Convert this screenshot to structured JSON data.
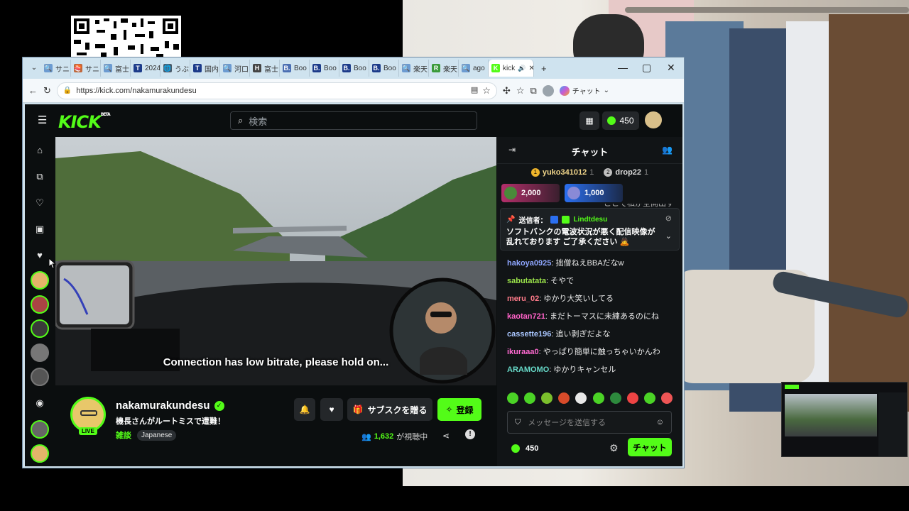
{
  "browser": {
    "tabs": [
      {
        "label": "サニ",
        "color": "#6c9bd1",
        "glyph": "🔍"
      },
      {
        "label": "サニ",
        "color": "#c0663b",
        "glyph": "🍣"
      },
      {
        "label": "富士",
        "color": "#6c9bd1",
        "glyph": "🔍"
      },
      {
        "label": "2024",
        "color": "#1c3b8a",
        "glyph": "T"
      },
      {
        "label": "うぶ",
        "color": "#4a5a6a",
        "glyph": "🌐"
      },
      {
        "label": "国内",
        "color": "#1c3b8a",
        "glyph": "T"
      },
      {
        "label": "河口",
        "color": "#6c9bd1",
        "glyph": "🔍"
      },
      {
        "label": "富士",
        "color": "#444",
        "glyph": "H"
      },
      {
        "label": "Boo",
        "color": "#4b6fb3",
        "glyph": "B."
      },
      {
        "label": "Boo",
        "color": "#1c3b8a",
        "glyph": "B."
      },
      {
        "label": "Boo",
        "color": "#1c3b8a",
        "glyph": "B."
      },
      {
        "label": "Boo",
        "color": "#1c3b8a",
        "glyph": "B."
      },
      {
        "label": "楽天",
        "color": "#6c9bd1",
        "glyph": "🔍"
      },
      {
        "label": "楽天",
        "color": "#3a9a3a",
        "glyph": "R"
      },
      {
        "label": "ago",
        "color": "#6c9bd1",
        "glyph": "🔍"
      },
      {
        "label": "kick",
        "color": "#53fc18",
        "glyph": "K"
      }
    ],
    "url": "https://kick.com/nakamurakundesu",
    "copilot_label": "チャット"
  },
  "kick": {
    "logo": "KICK",
    "logo_sup": "BETA",
    "search_placeholder": "検索",
    "points": "450"
  },
  "stream": {
    "overlay_text": "Connection has low bitrate, please hold on...",
    "channel_name": "nakamurakundesu",
    "title": "機長さんがルートミスで遭難！",
    "category": "雑談",
    "language": "Japanese",
    "live_badge": "LIVE",
    "viewers": "1,632",
    "viewers_suffix": "が視聴中",
    "gift_sub_label": "サブスクを贈る",
    "follow_label": "登録"
  },
  "chat": {
    "title": "チャット",
    "top_gifters": [
      {
        "rank": "1",
        "name": "yuko341012",
        "count": "1"
      },
      {
        "rank": "2",
        "name": "drop22",
        "count": "1"
      }
    ],
    "kicks": [
      {
        "amount": "2,000"
      },
      {
        "amount": "1,000"
      }
    ],
    "peek_text": "ここで私が全開出す",
    "pinned": {
      "label": "送信者：",
      "sender": "Lindtdesu",
      "text": "ソフトバンクの電波状況が悪く配信映像が乱れております ご了承ください 🙇"
    },
    "messages": [
      {
        "user": "hakoya0925",
        "color": "#8ea6ff",
        "text": "拙僧ねえBBAだなw"
      },
      {
        "user": "sabutatata",
        "color": "#9be34a",
        "text": "そやで"
      },
      {
        "user": "meru_02",
        "color": "#ff7b8a",
        "text": "ゆかり大笑いしてる"
      },
      {
        "user": "kaotan721",
        "color": "#ff62c8",
        "text": "まだトーマスに未練あるのにね"
      },
      {
        "user": "cassette196",
        "color": "#a9c6ff",
        "text": "追い剥ぎだよな"
      },
      {
        "user": "ikuraaa0",
        "color": "#ff6ad1",
        "text": "やっぱり簡単に触っちゃいかんわ"
      },
      {
        "user": "ARAMOMO",
        "color": "#67d9c8",
        "text": "ゆかりキャンセル"
      }
    ],
    "input_placeholder": "メッセージを送信する",
    "points": "450",
    "send_label": "チャット"
  }
}
